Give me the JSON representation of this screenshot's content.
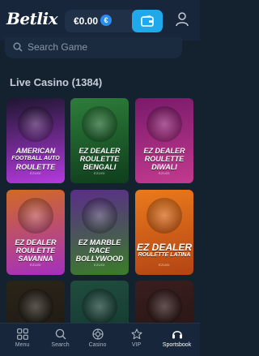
{
  "header": {
    "logo": "Betlix",
    "balance": "€0.00",
    "currency_symbol": "€"
  },
  "search": {
    "placeholder": "Search Game"
  },
  "section": {
    "title": "Live Casino (1384)"
  },
  "games": [
    {
      "lines": [
        "AMERICAN",
        "FOOTBALL AUTO",
        "ROULETTE"
      ],
      "provider": "EZUGI",
      "colors": [
        "#1e1630",
        "#b53adf"
      ]
    },
    {
      "lines": [
        "EZ DEALER",
        "ROULETTE",
        "BENGALI"
      ],
      "provider": "EZUGI",
      "colors": [
        "#2d7d3a",
        "#0f3d1c"
      ]
    },
    {
      "lines": [
        "EZ DEALER",
        "ROULETTE",
        "DIWALI"
      ],
      "provider": "EZUGI",
      "colors": [
        "#7a1a6a",
        "#c23a8f"
      ]
    },
    {
      "lines": [
        "EZ DEALER",
        "ROULETTE",
        "SAVANNA"
      ],
      "provider": "EZUGI",
      "colors": [
        "#d06a25",
        "#a42fbf"
      ]
    },
    {
      "lines": [
        "EZ MARBLE",
        "RACE",
        "BOLLYWOOD"
      ],
      "provider": "EZUGI",
      "colors": [
        "#5b2d8a",
        "#3a7d28"
      ]
    },
    {
      "lines": [
        "EZ DEALER",
        "ROULETTE LATINA"
      ],
      "provider": "EZUGI",
      "colors": [
        "#ea7a1c",
        "#b34414"
      ]
    },
    {
      "lines": [],
      "provider": "",
      "colors": [
        "#2a2418",
        "#1a1512"
      ]
    },
    {
      "lines": [],
      "provider": "",
      "colors": [
        "#1f4d3e",
        "#12302a"
      ]
    },
    {
      "lines": [],
      "provider": "",
      "colors": [
        "#3a1e1e",
        "#201010"
      ]
    }
  ],
  "nav": [
    {
      "label": "Menu",
      "icon": "grid-icon"
    },
    {
      "label": "Search",
      "icon": "search-icon"
    },
    {
      "label": "Casino",
      "icon": "casino-chip-icon"
    },
    {
      "label": "VIP",
      "icon": "star-icon"
    },
    {
      "label": "Sportsbook",
      "icon": "headset-icon"
    }
  ]
}
